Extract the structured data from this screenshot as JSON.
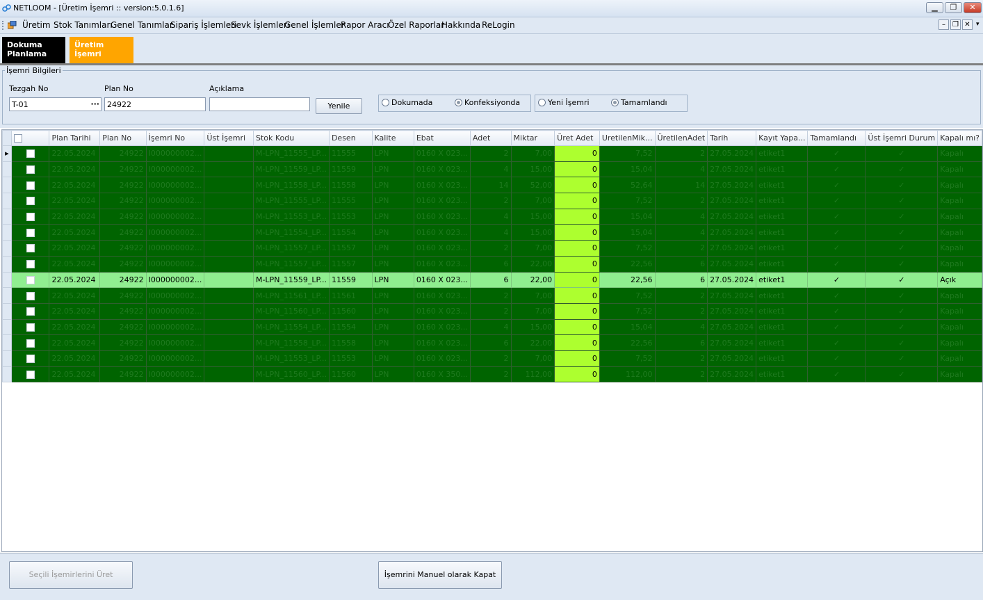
{
  "window": {
    "title": "NETLOOM - [Üretim İşemri :: version:5.0.1.6]"
  },
  "menu": [
    "Üretim",
    "Stok Tanımları",
    "Genel Tanımlar",
    "Sipariş İşlemleri",
    "Sevk İşlemleri",
    "Genel İşlemler",
    "Rapor Aracı",
    "Özel Raporlar",
    "Hakkında",
    "ReLogin"
  ],
  "tabs": [
    {
      "label": "Dokuma Planlama"
    },
    {
      "label": "Üretim İşemri",
      "active": true
    }
  ],
  "form": {
    "group_title": "İşemri Bilgileri",
    "tezgah_label": "Tezgah No",
    "tezgah_value": "T-01",
    "plan_label": "Plan No",
    "plan_value": "24922",
    "aciklama_label": "Açıklama",
    "aciklama_value": "",
    "refresh_button": "Yenile",
    "radios1": [
      {
        "label": "Dokumada",
        "checked": false
      },
      {
        "label": "Konfeksiyonda",
        "checked": true
      }
    ],
    "radios2": [
      {
        "label": "Yeni İşemri",
        "checked": false
      },
      {
        "label": "Tamamlandı",
        "checked": true
      }
    ]
  },
  "grid": {
    "columns": [
      "Plan Tarihi",
      "Plan No",
      "İşemri No",
      "Üst İşemri",
      "Stok Kodu",
      "Desen",
      "Kalite",
      "Ebat",
      "Adet",
      "Miktar",
      "Üret Adet",
      "UretilenMik...",
      "ÜretilenAdet",
      "Tarih",
      "Kayıt Yapa...",
      "Tamamlandı",
      "Üst İşemri Durum",
      "Kapalı mı?"
    ],
    "rows": [
      [
        "22.05.2024",
        "24922",
        "I000000002...",
        "",
        "M-LPN_11555_LP...",
        "11555",
        "LPN",
        "0160 X 023...",
        "2",
        "7,00",
        "0",
        "7,52",
        "2",
        "27.05.2024",
        "etiket1",
        "✓",
        "✓",
        "Kapalı"
      ],
      [
        "22.05.2024",
        "24922",
        "I000000002...",
        "",
        "M-LPN_11559_LP...",
        "11559",
        "LPN",
        "0160 X 023...",
        "4",
        "15,00",
        "0",
        "15,04",
        "4",
        "27.05.2024",
        "etiket1",
        "✓",
        "✓",
        "Kapalı"
      ],
      [
        "22.05.2024",
        "24922",
        "I000000002...",
        "",
        "M-LPN_11558_LP...",
        "11558",
        "LPN",
        "0160 X 023...",
        "14",
        "52,00",
        "0",
        "52,64",
        "14",
        "27.05.2024",
        "etiket1",
        "✓",
        "✓",
        "Kapalı"
      ],
      [
        "22.05.2024",
        "24922",
        "I000000002...",
        "",
        "M-LPN_11555_LP...",
        "11555",
        "LPN",
        "0160 X 023...",
        "2",
        "7,00",
        "0",
        "7,52",
        "2",
        "27.05.2024",
        "etiket1",
        "✓",
        "✓",
        "Kapalı"
      ],
      [
        "22.05.2024",
        "24922",
        "I000000002...",
        "",
        "M-LPN_11553_LP...",
        "11553",
        "LPN",
        "0160 X 023...",
        "4",
        "15,00",
        "0",
        "15,04",
        "4",
        "27.05.2024",
        "etiket1",
        "✓",
        "✓",
        "Kapalı"
      ],
      [
        "22.05.2024",
        "24922",
        "I000000002...",
        "",
        "M-LPN_11554_LP...",
        "11554",
        "LPN",
        "0160 X 023...",
        "4",
        "15,00",
        "0",
        "15,04",
        "4",
        "27.05.2024",
        "etiket1",
        "✓",
        "✓",
        "Kapalı"
      ],
      [
        "22.05.2024",
        "24922",
        "I000000002...",
        "",
        "M-LPN_11557_LP...",
        "11557",
        "LPN",
        "0160 X 023...",
        "2",
        "7,00",
        "0",
        "7,52",
        "2",
        "27.05.2024",
        "etiket1",
        "✓",
        "✓",
        "Kapalı"
      ],
      [
        "22.05.2024",
        "24922",
        "I000000002...",
        "",
        "M-LPN_11557_LP...",
        "11557",
        "LPN",
        "0160 X 023...",
        "6",
        "22,00",
        "0",
        "22,56",
        "6",
        "27.05.2024",
        "etiket1",
        "✓",
        "✓",
        "Kapalı"
      ],
      [
        "22.05.2024",
        "24922",
        "I000000002...",
        "",
        "M-LPN_11559_LP...",
        "11559",
        "LPN",
        "0160 X 023...",
        "6",
        "22,00",
        "0",
        "22,56",
        "6",
        "27.05.2024",
        "etiket1",
        "✓",
        "✓",
        "Açık"
      ],
      [
        "22.05.2024",
        "24922",
        "I000000002...",
        "",
        "M-LPN_11561_LP...",
        "11561",
        "LPN",
        "0160 X 023...",
        "2",
        "7,00",
        "0",
        "7,52",
        "2",
        "27.05.2024",
        "etiket1",
        "✓",
        "✓",
        "Kapalı"
      ],
      [
        "22.05.2024",
        "24922",
        "I000000002...",
        "",
        "M-LPN_11560_LP...",
        "11560",
        "LPN",
        "0160 X 023...",
        "2",
        "7,00",
        "0",
        "7,52",
        "2",
        "27.05.2024",
        "etiket1",
        "✓",
        "✓",
        "Kapalı"
      ],
      [
        "22.05.2024",
        "24922",
        "I000000002...",
        "",
        "M-LPN_11554_LP...",
        "11554",
        "LPN",
        "0160 X 023...",
        "4",
        "15,00",
        "0",
        "15,04",
        "4",
        "27.05.2024",
        "etiket1",
        "✓",
        "✓",
        "Kapalı"
      ],
      [
        "22.05.2024",
        "24922",
        "I000000002...",
        "",
        "M-LPN_11558_LP...",
        "11558",
        "LPN",
        "0160 X 023...",
        "6",
        "22,00",
        "0",
        "22,56",
        "6",
        "27.05.2024",
        "etiket1",
        "✓",
        "✓",
        "Kapalı"
      ],
      [
        "22.05.2024",
        "24922",
        "I000000002...",
        "",
        "M-LPN_11553_LP...",
        "11553",
        "LPN",
        "0160 X 023...",
        "2",
        "7,00",
        "0",
        "7,52",
        "2",
        "27.05.2024",
        "etiket1",
        "✓",
        "✓",
        "Kapalı"
      ],
      [
        "22.05.2024",
        "24922",
        "I000000002...",
        "",
        "M-LPN_11560_LP...",
        "11560",
        "LPN",
        "0160 X 350...",
        "2",
        "112,00",
        "0",
        "112,00",
        "2",
        "27.05.2024",
        "etiket1",
        "✓",
        "✓",
        "Kapalı"
      ]
    ],
    "selected_row": 8,
    "current_row": 0,
    "colors": {
      "row": "#006400",
      "selected": "#90ee90",
      "uret_adet": "#adff2f"
    }
  },
  "footer": {
    "produce_button": "Seçili İşemirlerini Üret",
    "close_button": "İşemrini Manuel olarak Kapat"
  }
}
